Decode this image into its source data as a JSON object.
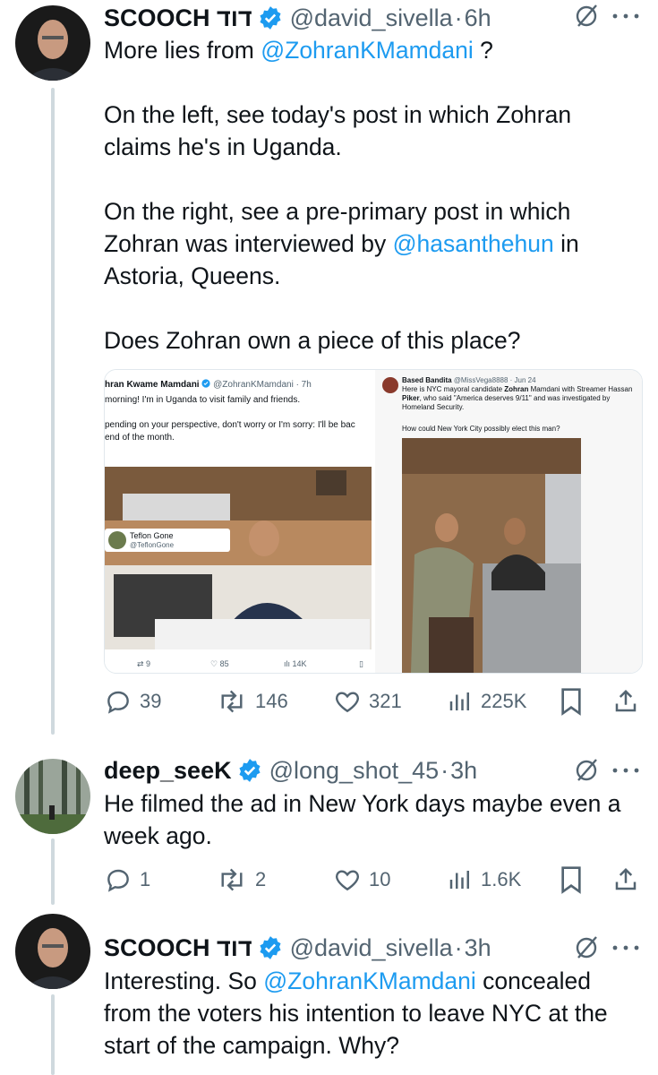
{
  "tweets": [
    {
      "name": "SCOOCH דוד",
      "handle": "@david_sivella",
      "dot": "·",
      "time": "6h",
      "text_lines": [
        [
          "More lies from ",
          "@ZohranKMamdani",
          " ?"
        ],
        "On the left, see today's post in which Zohran claims he's in Uganda.",
        [
          "On the right, see a pre-primary post in which Zohran was interviewed by ",
          "@hasanthehun",
          " in Astoria, Queens."
        ],
        "Does Zohran own a piece of this place?"
      ],
      "stats": {
        "replies": "39",
        "reposts": "146",
        "likes": "321",
        "views": "225K"
      }
    },
    {
      "name": "deep_seeK",
      "handle": "@long_shot_45",
      "dot": "·",
      "time": "3h",
      "text": "He filmed the ad in New York days maybe even a week ago.",
      "stats": {
        "replies": "1",
        "reposts": "2",
        "likes": "10",
        "views": "1.6K"
      }
    },
    {
      "name": "SCOOCH דוד",
      "handle": "@david_sivella",
      "dot": "·",
      "time": "3h",
      "text_parts": [
        "Interesting. So ",
        "@ZohranKMamdani",
        " concealed from the voters his intention to leave NYC at the start of the campaign. Why?"
      ]
    }
  ],
  "embed_left": {
    "author": "hran Kwame Mamdani",
    "handle": "@ZohranKMamdani · 7h",
    "line1": "morning! I'm in Uganda to visit family and friends.",
    "line2": "pending on your perspective, don't worry or I'm sorry: I'll be bac",
    "line3": "end of the month.",
    "overlay_name": "Teflon Gone",
    "overlay_handle": "@TeflonGone",
    "reposts": "9",
    "likes": "85",
    "views": "14K"
  },
  "embed_right": {
    "author": "Based Bandita",
    "handle": "@MissVega8888 · Jun 24",
    "line1_a": "Here is NYC mayoral candidate ",
    "line1_b": "Zohran",
    "line1_c": " Mamdani with Streamer Hassan",
    "line2_a": "Piker",
    "line2_b": ", who said \"America deserves 9/11\" and was investigated by",
    "line3": "Homeland Security.",
    "line4": "How could New York City possibly elect this man?"
  },
  "colors": {
    "accent": "#1d9bf0",
    "text": "#0f1419",
    "muted": "#536471",
    "line": "#cfd9de"
  }
}
